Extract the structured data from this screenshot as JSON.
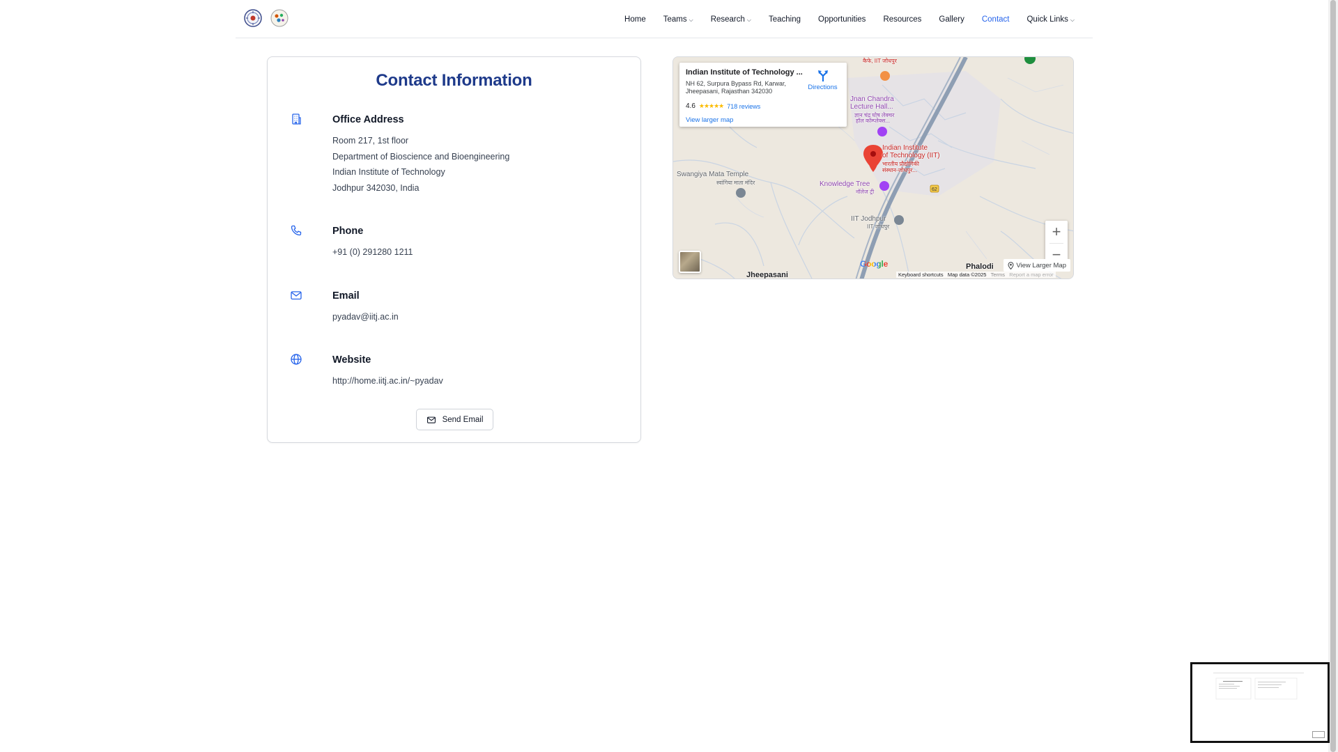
{
  "nav": {
    "items": [
      {
        "label": "Home",
        "dropdown": false,
        "active": false
      },
      {
        "label": "Teams",
        "dropdown": true,
        "active": false
      },
      {
        "label": "Research",
        "dropdown": true,
        "active": false
      },
      {
        "label": "Teaching",
        "dropdown": false,
        "active": false
      },
      {
        "label": "Opportunities",
        "dropdown": false,
        "active": false
      },
      {
        "label": "Resources",
        "dropdown": false,
        "active": false
      },
      {
        "label": "Gallery",
        "dropdown": false,
        "active": false
      },
      {
        "label": "Contact",
        "dropdown": false,
        "active": true
      },
      {
        "label": "Quick Links",
        "dropdown": true,
        "active": false
      }
    ],
    "active_color": "#2563eb"
  },
  "contact": {
    "title": "Contact Information",
    "title_color": "#1e3a8a",
    "office": {
      "icon": "building-icon",
      "title": "Office Address",
      "lines": [
        "Room 217, 1st floor",
        "Department of Bioscience and Bioengineering",
        "Indian Institute of Technology",
        "Jodhpur 342030, India"
      ]
    },
    "phone": {
      "icon": "phone-icon",
      "title": "Phone",
      "value": "+91 (0) 291280 1211"
    },
    "email": {
      "icon": "mail-icon",
      "title": "Email",
      "value": "pyadav@iitj.ac.in"
    },
    "website": {
      "icon": "globe-icon",
      "title": "Website",
      "value": "http://home.iitj.ac.in/~pyadav"
    },
    "send_button": {
      "label": "Send Email",
      "icon": "mail-icon"
    }
  },
  "map": {
    "place_name": "Indian Institute of Technology ...",
    "address": "NH 62, Surpura Bypass Rd, Karwar, Jheepasani, Rajasthan 342030",
    "rating": "4.6",
    "stars": "★★★★★",
    "reviews": "718 reviews",
    "view_larger": "View larger map",
    "directions": "Directions",
    "labels": {
      "jnan_1": "Jnan Chandra",
      "jnan_2": "Lecture Hall...",
      "jnan_hi_1": "ज्ञान चंद्र घोष लेक्चर",
      "jnan_hi_2": "हॉल कॉम्प्लेक्स...",
      "iit_1": "Indian Institute",
      "iit_2": "of Technology (IIT)",
      "iit_hi": "भारतीय प्रौद्योगिकी",
      "iit_hi_2": "संस्थान-जोधपुर...",
      "temple": "Swangiya Mata Temple",
      "temple_hi": "स्वांगिया माता मंदिर",
      "tree": "Knowledge Tree",
      "tree_hi": "नॉलेज ट्री",
      "iitj": "IIT Jodhpur",
      "iitj_hi": "IIT जोधपुर",
      "jheepasani": "Jheepasani",
      "phalodi": "Phalodi",
      "road_62": "62",
      "top_hi": "कैफे, IIT जोधपुर"
    },
    "google": "Google",
    "keyboard": "Keyboard shortcuts",
    "mapdata": "Map data ©2025",
    "terms": "Terms",
    "report": "Report a map error",
    "view_larger_btn": "View Larger Map",
    "zoom_in": "+",
    "zoom_out": "−"
  }
}
